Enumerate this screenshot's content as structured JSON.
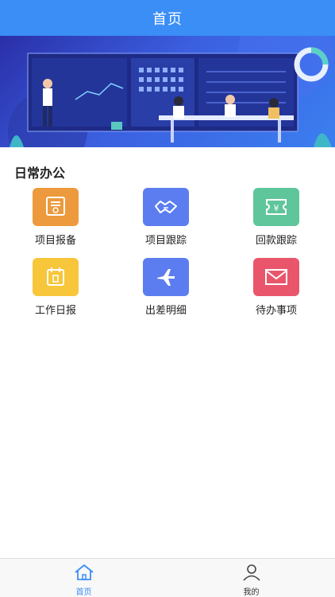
{
  "header": {
    "title": "首页"
  },
  "banner": {
    "image": "office-meeting-illustration"
  },
  "section": {
    "title": "日常办公"
  },
  "tiles": [
    {
      "label": "项目报备",
      "icon": "certificate-icon",
      "color": "#ec9a3d"
    },
    {
      "label": "项目跟踪",
      "icon": "handshake-icon",
      "color": "#5b7df0"
    },
    {
      "label": "回款跟踪",
      "icon": "ticket-yen-icon",
      "color": "#5fc59a"
    },
    {
      "label": "工作日报",
      "icon": "calendar-icon",
      "color": "#f7c63a"
    },
    {
      "label": "出差明细",
      "icon": "airplane-icon",
      "color": "#5b7df0"
    },
    {
      "label": "待办事项",
      "icon": "envelope-icon",
      "color": "#e9566b"
    }
  ],
  "tabbar": {
    "items": [
      {
        "label": "首页",
        "icon": "home-icon",
        "active": true
      },
      {
        "label": "我的",
        "icon": "person-icon",
        "active": false
      }
    ],
    "active_color": "#3a8ef6"
  }
}
